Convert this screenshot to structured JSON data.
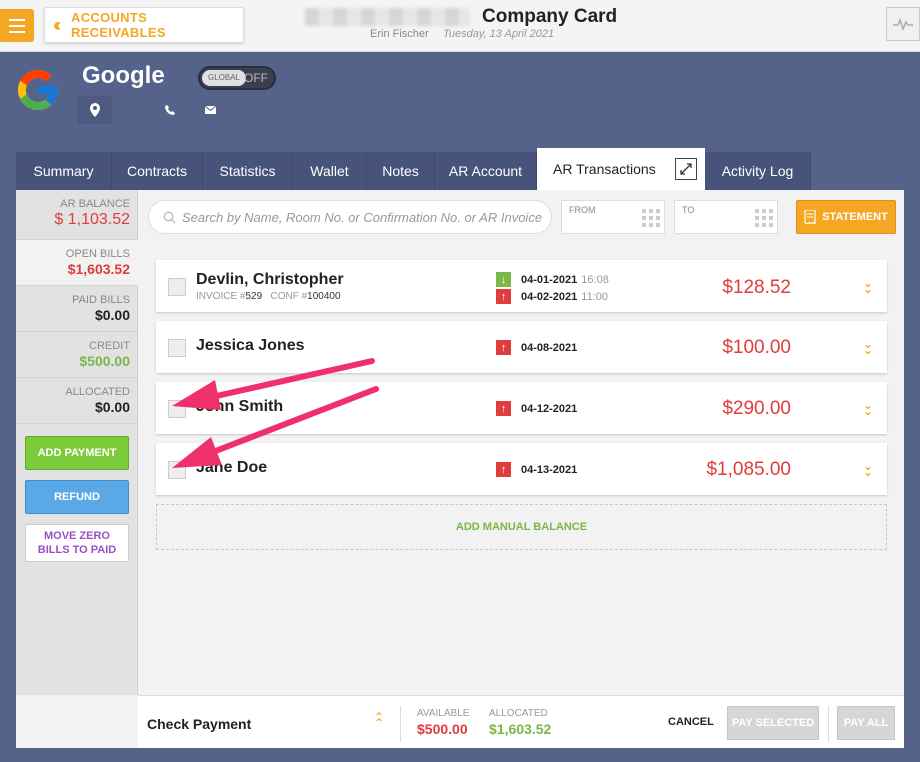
{
  "header": {
    "back_label": "ACCOUNTS RECEIVABLES",
    "title": "Company Card",
    "user": "Erin Fischer",
    "date": "Tuesday, 13 April 2021"
  },
  "company": {
    "name": "Google",
    "toggle_label": "GLOBAL",
    "toggle_state": "OFF"
  },
  "tabs": [
    {
      "label": "Summary",
      "active": false
    },
    {
      "label": "Contracts",
      "active": false
    },
    {
      "label": "Statistics",
      "active": false
    },
    {
      "label": "Wallet",
      "active": false
    },
    {
      "label": "Notes",
      "active": false
    },
    {
      "label": "AR Account",
      "active": false
    },
    {
      "label": "AR Transactions",
      "active": true
    },
    {
      "label": "Activity Log",
      "active": false
    }
  ],
  "summary": {
    "ar_balance_label": "AR BALANCE",
    "ar_balance": "$ 1,103.52",
    "open_bills_label": "OPEN BILLS",
    "open_bills": "$1,603.52",
    "paid_bills_label": "PAID BILLS",
    "paid_bills": "$0.00",
    "credit_label": "CREDIT",
    "credit": "$500.00",
    "allocated_label": "ALLOCATED",
    "allocated": "$0.00"
  },
  "actions": {
    "add_payment": "ADD PAYMENT",
    "refund": "REFUND",
    "move_zero_line1": "MOVE ZERO",
    "move_zero_line2": "BILLS TO PAID"
  },
  "filters": {
    "search_placeholder": "Search by Name, Room No. or Confirmation No. or AR Invoice No.",
    "from_label": "FROM",
    "to_label": "TO",
    "statement_label": "STATEMENT"
  },
  "bills": [
    {
      "name": "Devlin, Christopher",
      "invoice_label": "INVOICE #",
      "invoice": "529",
      "conf_label": "CONF #",
      "conf": "100400",
      "dates": [
        {
          "dir": "in",
          "date": "04-01-2021",
          "time": "16:08"
        },
        {
          "dir": "out",
          "date": "04-02-2021",
          "time": "11:00"
        }
      ],
      "amount": "$128.52"
    },
    {
      "name": "Jessica Jones",
      "dates": [
        {
          "dir": "out",
          "date": "04-08-2021",
          "time": ""
        }
      ],
      "amount": "$100.00"
    },
    {
      "name": "John Smith",
      "dates": [
        {
          "dir": "out",
          "date": "04-12-2021",
          "time": ""
        }
      ],
      "amount": "$290.00"
    },
    {
      "name": "Jane Doe",
      "dates": [
        {
          "dir": "out",
          "date": "04-13-2021",
          "time": ""
        }
      ],
      "amount": "$1,085.00"
    }
  ],
  "add_manual_balance": "ADD MANUAL BALANCE",
  "footer": {
    "method": "Check Payment",
    "available_label": "AVAILABLE",
    "available": "$500.00",
    "allocated_label": "ALLOCATED",
    "allocated": "$1,603.52",
    "cancel": "CANCEL",
    "pay_selected": "PAY SELECTED",
    "pay_all": "PAY ALL"
  },
  "colors": {
    "accent": "#f5a623",
    "background": "#55628a",
    "tab_bg": "#47537a",
    "amount_red": "#e03c3c",
    "credit_green": "#7ab648",
    "annotation_arrow": "#f0306a"
  }
}
